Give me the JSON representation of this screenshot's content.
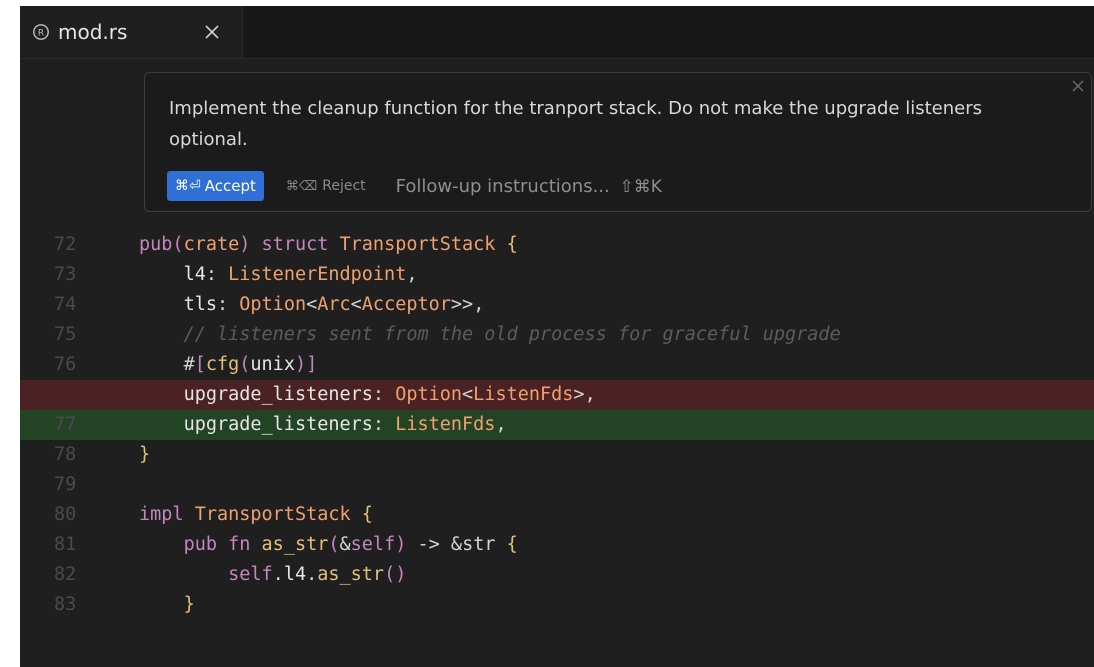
{
  "tab": {
    "filename": "mod.rs",
    "icon": "rust-file-icon",
    "close_icon": "close-icon"
  },
  "prompt": {
    "instruction": "Implement the cleanup function for the tranport stack. Do not make the upgrade listeners optional.",
    "accept_shortcut": "⌘⏎",
    "accept_label": "Accept",
    "reject_shortcut": "⌘⌫",
    "reject_label": "Reject",
    "followup_placeholder": "Follow-up instructions...",
    "followup_shortcut": "⇧⌘K"
  },
  "code": {
    "line_numbers": [
      "72",
      "73",
      "74",
      "75",
      "76",
      "",
      "77",
      "78",
      "79",
      "80",
      "81",
      "82",
      "83"
    ],
    "lines": [
      "pub(crate) struct TransportStack {",
      "    l4: ListenerEndpoint,",
      "    tls: Option<Arc<Acceptor>>,",
      "    // listeners sent from the old process for graceful upgrade",
      "    #[cfg(unix)]",
      "    upgrade_listeners: Option<ListenFds>,",
      "    upgrade_listeners: ListenFds,",
      "}",
      "",
      "impl TransportStack {",
      "    pub fn as_str(&self) -> &str {",
      "        self.l4.as_str()",
      "    }"
    ],
    "removed_line_index": 5,
    "added_line_index": 6
  },
  "colors": {
    "editor_bg": "#1f1f1f",
    "accept_button": "#2f6fd6",
    "removed_bg": "#4a2223",
    "added_bg": "#234424"
  }
}
